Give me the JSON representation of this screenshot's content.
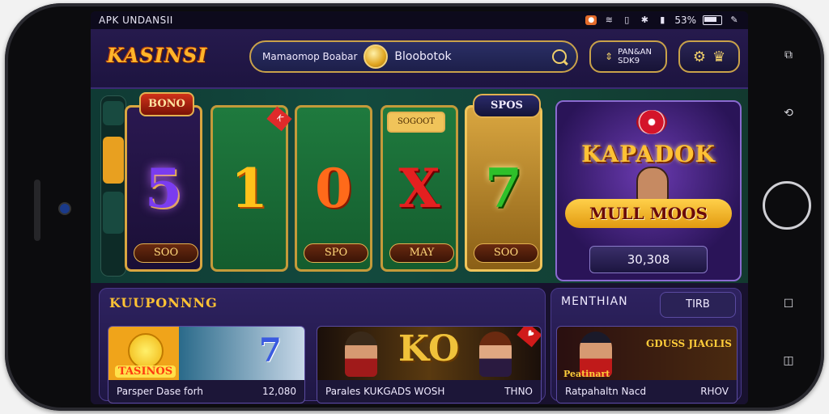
{
  "status_bar": {
    "left_text": "APK UNDANSII",
    "battery_text": "53%"
  },
  "header": {
    "logo": "KASINSI",
    "search_left": "Mamaomop Boabar",
    "search_right": "Bloobotok",
    "download_line1": "PAN&AN",
    "download_line2": "SDK9"
  },
  "reels": {
    "bonus_badge": "BONO",
    "spin_badge": "SPOS",
    "small_badge": "SOGOOT",
    "items": [
      {
        "symbol": "5",
        "label": "SOO"
      },
      {
        "symbol": "1",
        "label": ""
      },
      {
        "symbol": "0",
        "label": "SPO"
      },
      {
        "symbol": "X",
        "label": "MAY"
      },
      {
        "symbol": "7",
        "label": "SOO"
      }
    ],
    "corner_tag": "K"
  },
  "jackpot": {
    "title": "KAPADOK",
    "subtitle": "MULL MOOS",
    "value": "30,308"
  },
  "coupons": {
    "title": "KUUPONNNG",
    "cards": [
      {
        "name": "Parsper Dase forh",
        "value": "12,080",
        "logo": "TASINOS",
        "art": "7"
      },
      {
        "name": "Parales KUKGADS WOSH",
        "value": "THNO",
        "art": "KO"
      },
      {}
    ]
  },
  "right_panel": {
    "title": "MENTHIAN",
    "tab": "TIRB",
    "card": {
      "name": "Ratpahaltn Nacd",
      "value": "RHOV",
      "label": "Peatinart",
      "promo": "GDUSS JIAGLIS"
    }
  },
  "colors": {
    "accent_gold": "#ffc234",
    "background": "#1b1436",
    "table_green": "#134a3e"
  }
}
